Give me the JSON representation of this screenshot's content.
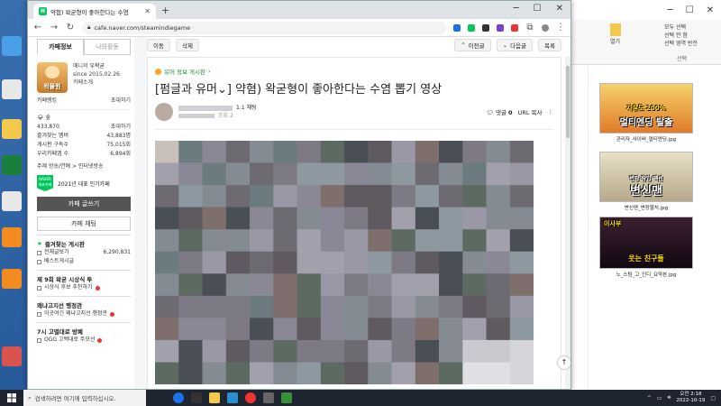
{
  "browser": {
    "tab_title": "약혐) 왁굳형이 좋아한다는 수염",
    "favicon_letter": "N",
    "url": "cafe.naver.com/steamindiegame"
  },
  "sidebar": {
    "tabs": [
      "카페정보",
      "나의활동"
    ],
    "manager_label": "매니저",
    "manager_name": "우왁굳",
    "since": "since 2015.02.26.",
    "cafe_intro": "카페소개",
    "avatar_text": "왁물원",
    "cafe_grade": "카페랭킹",
    "invite": "초대하기",
    "level_label": "숲",
    "level_stats": [
      {
        "label": "433,870",
        "value": "초대하기"
      }
    ],
    "stats": [
      {
        "label": "즐겨찾는 멤버",
        "value": "43,883명"
      },
      {
        "label": "게시판 구독수",
        "value": "75,015회"
      },
      {
        "label": "우리카페앱 수",
        "value": "6,894회"
      }
    ],
    "topic": "주제 방송/연예 > 인터넷방송",
    "naver_badge": "NAVER 대표카페",
    "badge_text": "2021년 대표 인기카페",
    "write_button": "카페 글쓰기",
    "chat_button": "카페 채팅",
    "fav_board_head": "즐겨찾는 게시판",
    "menu_items": [
      {
        "label": "전체글보기",
        "count": "6,290,831",
        "new": false
      },
      {
        "label": "베스트게시글",
        "count": "",
        "new": false
      }
    ],
    "section2_head": "제 9회 왁굳 시상식 투",
    "section2_items": [
      {
        "label": "시상식 후보 추천하기",
        "new": true
      }
    ],
    "section3_head": "왜냐고지선 행정관",
    "section3_items": [
      {
        "label": "이곳여긴 왜냐고지선 행정관",
        "new": true
      }
    ],
    "section4_head": "7시 고별대로 방폐",
    "section4_items": [
      {
        "label": "OGG 고백대로 주모선",
        "new": true
      }
    ]
  },
  "article_toolbar": {
    "left": [
      "이동",
      "삭제"
    ],
    "prev": "이전글",
    "next": "다음글",
    "list": "목록"
  },
  "article": {
    "board": "유머 정보 게시판",
    "title": "[펌글과 유머⌄] 약혐) 왁굳형이 좋아한다는 수염 뽑기 영상",
    "author_grade": "1:1 채팅",
    "view_label": "조회 2",
    "comments_label": "댓글",
    "comments_count": "0",
    "url_copy": "URL 복사"
  },
  "explorer": {
    "thumbs": [
      {
        "caption": "관리자_사이버_멀티엔딩.jpg",
        "big": "멀티엔딩 탈출",
        "sub": "자유도 200%",
        "color": "#c8552a"
      },
      {
        "caption": "변신맨_변장물처.jpg",
        "big": "변신맨",
        "sub": "변장 잠입 액션",
        "color": "#5a6fa0"
      },
      {
        "caption": "노_스팀_고_인디_요약본.jpg",
        "big": "웃는 친구들",
        "sub": "이사부",
        "color": "#2a1a2a"
      }
    ],
    "ribbon_groups": [
      "열기",
      "선택"
    ],
    "ribbon_items": [
      "모두 선택",
      "선택 안 함",
      "선택 영역 반전"
    ]
  },
  "taskbar": {
    "search_placeholder": "검색하려면 여기에 입력하십시오.",
    "time": "오전 2:18",
    "date": "2022-10-19"
  },
  "colors": {
    "naver_green": "#03c75a",
    "taskbar": "#1f2530"
  }
}
